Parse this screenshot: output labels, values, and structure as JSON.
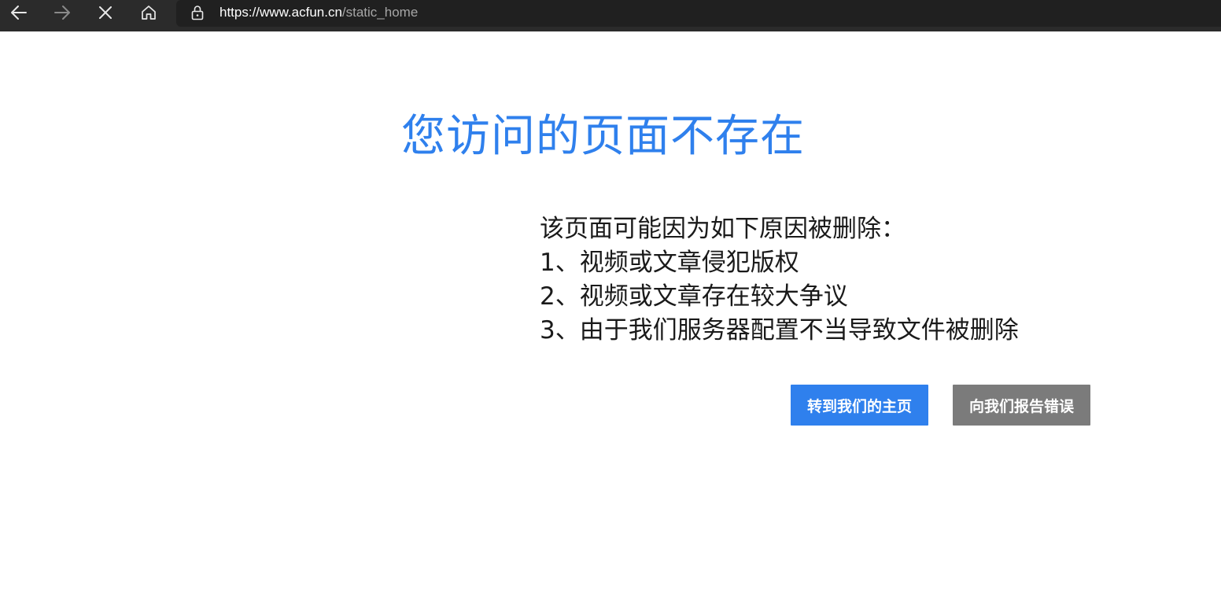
{
  "browser": {
    "url_host": "https://www.acfun.cn",
    "url_path": "/static_home"
  },
  "page": {
    "title": "您访问的页面不存在",
    "reasons_intro": "该页面可能因为如下原因被删除：",
    "reasons": [
      "1、视频或文章侵犯版权",
      "2、视频或文章存在较大争议",
      "3、由于我们服务器配置不当导致文件被删除"
    ],
    "buttons": {
      "home": "转到我们的主页",
      "report": "向我们报告错误"
    }
  },
  "colors": {
    "accent": "#2f80ed",
    "report_button": "#7b7b7b",
    "toolbar": "#2b2b2b",
    "address_bar": "#202020"
  },
  "icons": {
    "back": "back-arrow-icon",
    "forward": "forward-arrow-icon",
    "stop": "close-icon",
    "home": "home-icon",
    "lock": "lock-icon"
  }
}
